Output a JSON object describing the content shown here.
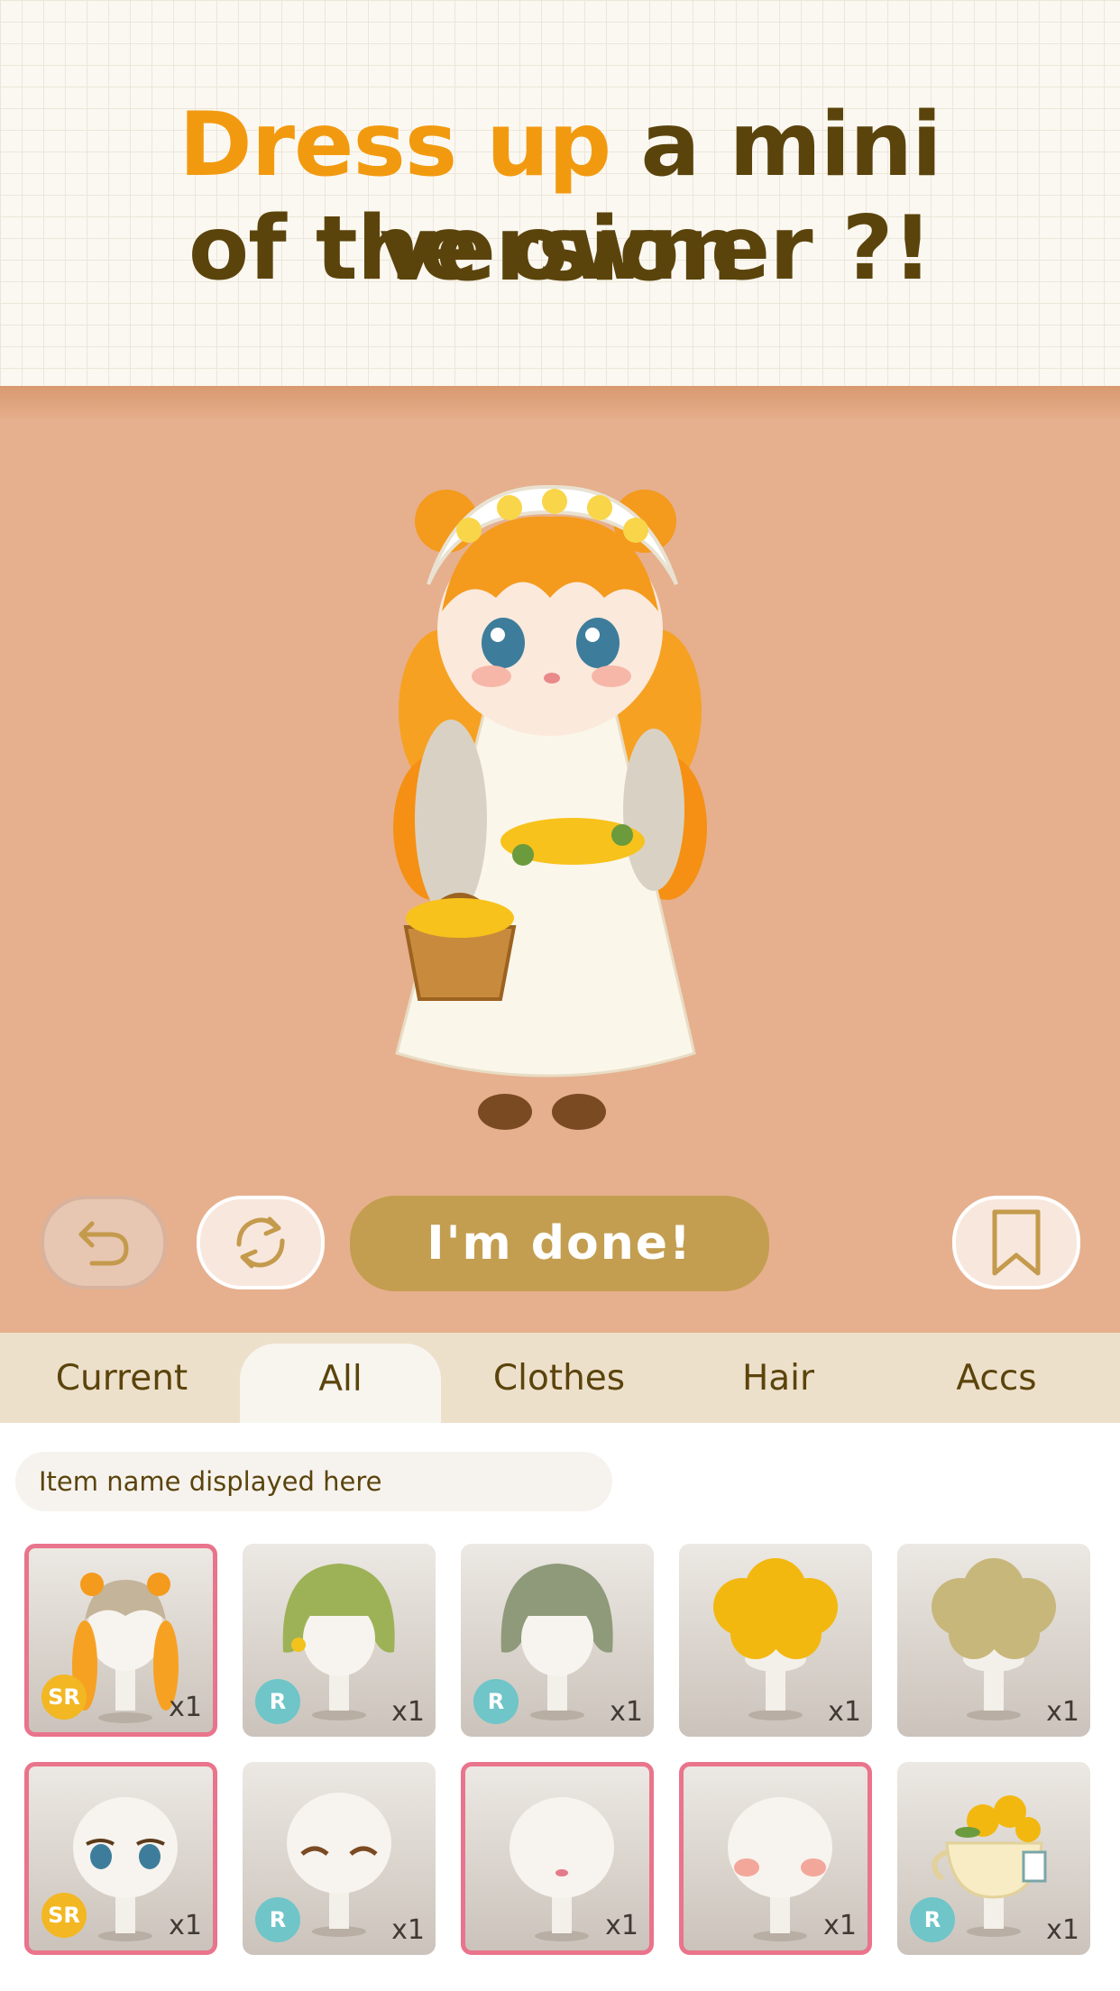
{
  "headline": {
    "highlight": "Dress up",
    "line1_rest": " a mini version",
    "line2": "of the owner ?!"
  },
  "controls": {
    "undo_icon": "undo-arrow-icon",
    "refresh_icon": "refresh-icon",
    "done_label": "I'm done!",
    "bookmark_icon": "bookmark-icon"
  },
  "tabs": [
    {
      "label": "Current",
      "active": false
    },
    {
      "label": "All",
      "active": true
    },
    {
      "label": "Clothes",
      "active": false
    },
    {
      "label": "Hair",
      "active": false
    },
    {
      "label": "Accs",
      "active": false
    }
  ],
  "search": {
    "placeholder": "Item name displayed here"
  },
  "items": [
    {
      "name": "orange-twin-braid-hair",
      "rarity": "SR",
      "count": "x1",
      "selected": true
    },
    {
      "name": "green-bob-hair-with-flower",
      "rarity": "R",
      "count": "x1",
      "selected": false
    },
    {
      "name": "gray-green-bob-hair",
      "rarity": "R",
      "count": "x1",
      "selected": false
    },
    {
      "name": "yellow-fluffy-hair",
      "rarity": "",
      "count": "x1",
      "selected": false
    },
    {
      "name": "olive-fluffy-hair",
      "rarity": "",
      "count": "x1",
      "selected": false
    },
    {
      "name": "teary-blue-eyes",
      "rarity": "SR",
      "count": "x1",
      "selected": true
    },
    {
      "name": "smiling-closed-eyes",
      "rarity": "R",
      "count": "x1",
      "selected": false
    },
    {
      "name": "small-mouth",
      "rarity": "",
      "count": "x1",
      "selected": true
    },
    {
      "name": "blush-cheeks",
      "rarity": "",
      "count": "x1",
      "selected": true
    },
    {
      "name": "teacup-flower-accessory",
      "rarity": "R",
      "count": "x1",
      "selected": false
    }
  ],
  "colors": {
    "headline": "#5b440c",
    "highlight": "#f29a0f",
    "stage": "#e6b08e",
    "done_button": "#c39e50",
    "selected_border": "#e9748c",
    "sr_badge": "#f2b722",
    "r_badge": "#6fc5c8"
  }
}
